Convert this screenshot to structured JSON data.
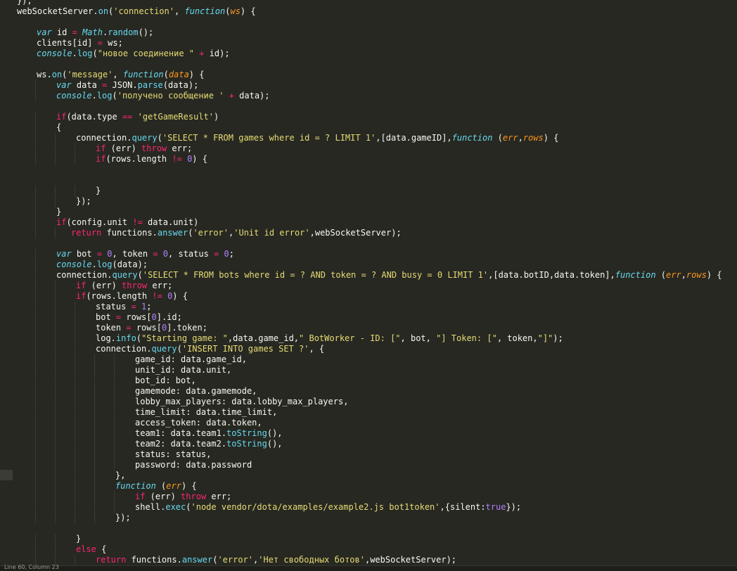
{
  "editor": {
    "theme": {
      "bg": "#272822",
      "plain": "#F8F8F2",
      "keyword": "#F92672",
      "function": "#66D9EF",
      "string": "#E6DB74",
      "number": "#AE81FF",
      "param": "#FD971F"
    },
    "lines": [
      {
        "indent": 3,
        "tokens": [
          {
            "t": "});",
            "c": "plain"
          }
        ]
      },
      {
        "indent": 3,
        "tokens": [
          {
            "t": "webSocketServer.",
            "c": "plain"
          },
          {
            "t": "on",
            "c": "fn"
          },
          {
            "t": "(",
            "c": "plain"
          },
          {
            "t": "'connection'",
            "c": "str"
          },
          {
            "t": ", ",
            "c": "plain"
          },
          {
            "t": "function",
            "c": "italic"
          },
          {
            "t": "(",
            "c": "plain"
          },
          {
            "t": "ws",
            "c": "param"
          },
          {
            "t": ") {",
            "c": "plain"
          }
        ]
      },
      {
        "indent": 0,
        "tokens": []
      },
      {
        "indent": 7,
        "tokens": [
          {
            "t": "var",
            "c": "italic"
          },
          {
            "t": " id ",
            "c": "plain"
          },
          {
            "t": "=",
            "c": "op"
          },
          {
            "t": " ",
            "c": "plain"
          },
          {
            "t": "Math",
            "c": "italic"
          },
          {
            "t": ".",
            "c": "plain"
          },
          {
            "t": "random",
            "c": "fn"
          },
          {
            "t": "();",
            "c": "plain"
          }
        ]
      },
      {
        "indent": 7,
        "tokens": [
          {
            "t": "clients[id] ",
            "c": "plain"
          },
          {
            "t": "=",
            "c": "op"
          },
          {
            "t": " ws;",
            "c": "plain"
          }
        ]
      },
      {
        "indent": 7,
        "tokens": [
          {
            "t": "console",
            "c": "italic"
          },
          {
            "t": ".",
            "c": "plain"
          },
          {
            "t": "log",
            "c": "fn"
          },
          {
            "t": "(",
            "c": "plain"
          },
          {
            "t": "\"новое соединение \"",
            "c": "str"
          },
          {
            "t": " ",
            "c": "plain"
          },
          {
            "t": "+",
            "c": "op"
          },
          {
            "t": " id);",
            "c": "plain"
          }
        ]
      },
      {
        "indent": 0,
        "tokens": []
      },
      {
        "indent": 7,
        "tokens": [
          {
            "t": "ws.",
            "c": "plain"
          },
          {
            "t": "on",
            "c": "fn"
          },
          {
            "t": "(",
            "c": "plain"
          },
          {
            "t": "'message'",
            "c": "str"
          },
          {
            "t": ", ",
            "c": "plain"
          },
          {
            "t": "function",
            "c": "italic"
          },
          {
            "t": "(",
            "c": "plain"
          },
          {
            "t": "data",
            "c": "param"
          },
          {
            "t": ") {",
            "c": "plain"
          }
        ]
      },
      {
        "indent": 11,
        "tokens": [
          {
            "t": "var",
            "c": "italic"
          },
          {
            "t": " data ",
            "c": "plain"
          },
          {
            "t": "=",
            "c": "op"
          },
          {
            "t": " JSON.",
            "c": "plain"
          },
          {
            "t": "parse",
            "c": "fn"
          },
          {
            "t": "(data);",
            "c": "plain"
          }
        ]
      },
      {
        "indent": 11,
        "tokens": [
          {
            "t": "console",
            "c": "italic"
          },
          {
            "t": ".",
            "c": "plain"
          },
          {
            "t": "log",
            "c": "fn"
          },
          {
            "t": "(",
            "c": "plain"
          },
          {
            "t": "'получено сообщение '",
            "c": "str"
          },
          {
            "t": " ",
            "c": "plain"
          },
          {
            "t": "+",
            "c": "op"
          },
          {
            "t": " data);",
            "c": "plain"
          }
        ]
      },
      {
        "indent": 0,
        "tokens": []
      },
      {
        "indent": 11,
        "tokens": [
          {
            "t": "if",
            "c": "key"
          },
          {
            "t": "(data.type ",
            "c": "plain"
          },
          {
            "t": "==",
            "c": "op"
          },
          {
            "t": " ",
            "c": "plain"
          },
          {
            "t": "'getGameResult'",
            "c": "str"
          },
          {
            "t": ")",
            "c": "plain"
          }
        ]
      },
      {
        "indent": 11,
        "tokens": [
          {
            "t": "{",
            "c": "plain"
          }
        ]
      },
      {
        "indent": 15,
        "tokens": [
          {
            "t": "connection.",
            "c": "plain"
          },
          {
            "t": "query",
            "c": "fn"
          },
          {
            "t": "(",
            "c": "plain"
          },
          {
            "t": "'SELECT * FROM games where id = ? LIMIT 1'",
            "c": "str"
          },
          {
            "t": ",[data.gameID],",
            "c": "plain"
          },
          {
            "t": "function",
            "c": "italic"
          },
          {
            "t": " (",
            "c": "plain"
          },
          {
            "t": "err",
            "c": "param"
          },
          {
            "t": ",",
            "c": "plain"
          },
          {
            "t": "rows",
            "c": "param"
          },
          {
            "t": ") {",
            "c": "plain"
          }
        ]
      },
      {
        "indent": 19,
        "tokens": [
          {
            "t": "if",
            "c": "key"
          },
          {
            "t": " (err) ",
            "c": "plain"
          },
          {
            "t": "throw",
            "c": "key"
          },
          {
            "t": " err;",
            "c": "plain"
          }
        ]
      },
      {
        "indent": 19,
        "tokens": [
          {
            "t": "if",
            "c": "key"
          },
          {
            "t": "(rows.length ",
            "c": "plain"
          },
          {
            "t": "!=",
            "c": "op"
          },
          {
            "t": " ",
            "c": "plain"
          },
          {
            "t": "0",
            "c": "num"
          },
          {
            "t": ") {",
            "c": "plain"
          }
        ]
      },
      {
        "indent": 0,
        "tokens": []
      },
      {
        "indent": 0,
        "tokens": []
      },
      {
        "indent": 19,
        "tokens": [
          {
            "t": "}",
            "c": "plain"
          }
        ]
      },
      {
        "indent": 15,
        "tokens": [
          {
            "t": "});",
            "c": "plain"
          }
        ]
      },
      {
        "indent": 11,
        "tokens": [
          {
            "t": "}",
            "c": "plain"
          }
        ]
      },
      {
        "indent": 11,
        "tokens": [
          {
            "t": "if",
            "c": "key"
          },
          {
            "t": "(config.unit ",
            "c": "plain"
          },
          {
            "t": "!=",
            "c": "op"
          },
          {
            "t": " data.unit)",
            "c": "plain"
          }
        ]
      },
      {
        "indent": 14,
        "tokens": [
          {
            "t": "return",
            "c": "key"
          },
          {
            "t": " functions.",
            "c": "plain"
          },
          {
            "t": "answer",
            "c": "fn"
          },
          {
            "t": "(",
            "c": "plain"
          },
          {
            "t": "'error'",
            "c": "str"
          },
          {
            "t": ",",
            "c": "plain"
          },
          {
            "t": "'Unit id error'",
            "c": "str"
          },
          {
            "t": ",webSocketServer);",
            "c": "plain"
          }
        ]
      },
      {
        "indent": 0,
        "tokens": []
      },
      {
        "indent": 11,
        "tokens": [
          {
            "t": "var",
            "c": "italic"
          },
          {
            "t": " bot ",
            "c": "plain"
          },
          {
            "t": "=",
            "c": "op"
          },
          {
            "t": " ",
            "c": "plain"
          },
          {
            "t": "0",
            "c": "num"
          },
          {
            "t": ", token ",
            "c": "plain"
          },
          {
            "t": "=",
            "c": "op"
          },
          {
            "t": " ",
            "c": "plain"
          },
          {
            "t": "0",
            "c": "num"
          },
          {
            "t": ", status ",
            "c": "plain"
          },
          {
            "t": "=",
            "c": "op"
          },
          {
            "t": " ",
            "c": "plain"
          },
          {
            "t": "0",
            "c": "num"
          },
          {
            "t": ";",
            "c": "plain"
          }
        ]
      },
      {
        "indent": 11,
        "tokens": [
          {
            "t": "console",
            "c": "italic"
          },
          {
            "t": ".",
            "c": "plain"
          },
          {
            "t": "log",
            "c": "fn"
          },
          {
            "t": "(data);",
            "c": "plain"
          }
        ]
      },
      {
        "indent": 11,
        "tokens": [
          {
            "t": "connection.",
            "c": "plain"
          },
          {
            "t": "query",
            "c": "fn"
          },
          {
            "t": "(",
            "c": "plain"
          },
          {
            "t": "'SELECT * FROM bots where id = ? AND token = ? AND busy = 0 LIMIT 1'",
            "c": "str"
          },
          {
            "t": ",[data.botID,data.token],",
            "c": "plain"
          },
          {
            "t": "function",
            "c": "italic"
          },
          {
            "t": " (",
            "c": "plain"
          },
          {
            "t": "err",
            "c": "param"
          },
          {
            "t": ",",
            "c": "plain"
          },
          {
            "t": "rows",
            "c": "param"
          },
          {
            "t": ") {",
            "c": "plain"
          }
        ]
      },
      {
        "indent": 15,
        "tokens": [
          {
            "t": "if",
            "c": "key"
          },
          {
            "t": " (err) ",
            "c": "plain"
          },
          {
            "t": "throw",
            "c": "key"
          },
          {
            "t": " err;",
            "c": "plain"
          }
        ]
      },
      {
        "indent": 15,
        "tokens": [
          {
            "t": "if",
            "c": "key"
          },
          {
            "t": "(rows.length ",
            "c": "plain"
          },
          {
            "t": "!=",
            "c": "op"
          },
          {
            "t": " ",
            "c": "plain"
          },
          {
            "t": "0",
            "c": "num"
          },
          {
            "t": ") {",
            "c": "plain"
          }
        ]
      },
      {
        "indent": 19,
        "tokens": [
          {
            "t": "status ",
            "c": "plain"
          },
          {
            "t": "=",
            "c": "op"
          },
          {
            "t": " ",
            "c": "plain"
          },
          {
            "t": "1",
            "c": "num"
          },
          {
            "t": ";",
            "c": "plain"
          }
        ]
      },
      {
        "indent": 19,
        "tokens": [
          {
            "t": "bot ",
            "c": "plain"
          },
          {
            "t": "=",
            "c": "op"
          },
          {
            "t": " rows[",
            "c": "plain"
          },
          {
            "t": "0",
            "c": "num"
          },
          {
            "t": "].id;",
            "c": "plain"
          }
        ]
      },
      {
        "indent": 19,
        "tokens": [
          {
            "t": "token ",
            "c": "plain"
          },
          {
            "t": "=",
            "c": "op"
          },
          {
            "t": " rows[",
            "c": "plain"
          },
          {
            "t": "0",
            "c": "num"
          },
          {
            "t": "].token;",
            "c": "plain"
          }
        ]
      },
      {
        "indent": 19,
        "tokens": [
          {
            "t": "log.",
            "c": "plain"
          },
          {
            "t": "info",
            "c": "fn"
          },
          {
            "t": "(",
            "c": "plain"
          },
          {
            "t": "\"Starting game: \"",
            "c": "str"
          },
          {
            "t": ",data.game_id,",
            "c": "plain"
          },
          {
            "t": "\" BotWorker - ID: [\"",
            "c": "str"
          },
          {
            "t": ", bot, ",
            "c": "plain"
          },
          {
            "t": "\"] Token: [\"",
            "c": "str"
          },
          {
            "t": ", token,",
            "c": "plain"
          },
          {
            "t": "\"]\"",
            "c": "str"
          },
          {
            "t": ");",
            "c": "plain"
          }
        ]
      },
      {
        "indent": 19,
        "tokens": [
          {
            "t": "connection.",
            "c": "plain"
          },
          {
            "t": "query",
            "c": "fn"
          },
          {
            "t": "(",
            "c": "plain"
          },
          {
            "t": "'INSERT INTO games SET ?'",
            "c": "str"
          },
          {
            "t": ", {",
            "c": "plain"
          }
        ]
      },
      {
        "indent": 27,
        "tokens": [
          {
            "t": "game_id: data.game_id,",
            "c": "plain"
          }
        ]
      },
      {
        "indent": 27,
        "tokens": [
          {
            "t": "unit_id: data.unit,",
            "c": "plain"
          }
        ]
      },
      {
        "indent": 27,
        "tokens": [
          {
            "t": "bot_id: bot,",
            "c": "plain"
          }
        ]
      },
      {
        "indent": 27,
        "tokens": [
          {
            "t": "gamemode: data.gamemode,",
            "c": "plain"
          }
        ]
      },
      {
        "indent": 27,
        "tokens": [
          {
            "t": "lobby_max_players: data.lobby_max_players,",
            "c": "plain"
          }
        ]
      },
      {
        "indent": 27,
        "tokens": [
          {
            "t": "time_limit: data.time_limit,",
            "c": "plain"
          }
        ]
      },
      {
        "indent": 27,
        "tokens": [
          {
            "t": "access_token: data.token,",
            "c": "plain"
          }
        ]
      },
      {
        "indent": 27,
        "tokens": [
          {
            "t": "team1: data.team1.",
            "c": "plain"
          },
          {
            "t": "toString",
            "c": "fn"
          },
          {
            "t": "(),",
            "c": "plain"
          }
        ]
      },
      {
        "indent": 27,
        "tokens": [
          {
            "t": "team2: data.team2.",
            "c": "plain"
          },
          {
            "t": "toString",
            "c": "fn"
          },
          {
            "t": "(),",
            "c": "plain"
          }
        ]
      },
      {
        "indent": 27,
        "tokens": [
          {
            "t": "status: status,",
            "c": "plain"
          }
        ]
      },
      {
        "indent": 27,
        "tokens": [
          {
            "t": "password: data.password",
            "c": "plain"
          }
        ]
      },
      {
        "indent": 23,
        "tokens": [
          {
            "t": "},",
            "c": "plain"
          }
        ]
      },
      {
        "indent": 23,
        "tokens": [
          {
            "t": "function",
            "c": "italic"
          },
          {
            "t": " (",
            "c": "plain"
          },
          {
            "t": "err",
            "c": "param"
          },
          {
            "t": ") {",
            "c": "plain"
          }
        ]
      },
      {
        "indent": 27,
        "tokens": [
          {
            "t": "if",
            "c": "key"
          },
          {
            "t": " (err) ",
            "c": "plain"
          },
          {
            "t": "throw",
            "c": "key"
          },
          {
            "t": " err;",
            "c": "plain"
          }
        ]
      },
      {
        "indent": 27,
        "tokens": [
          {
            "t": "shell.",
            "c": "plain"
          },
          {
            "t": "exec",
            "c": "fn"
          },
          {
            "t": "(",
            "c": "plain"
          },
          {
            "t": "'node vendor/dota/examples/example2.js bot1token'",
            "c": "str"
          },
          {
            "t": ",{silent:",
            "c": "plain"
          },
          {
            "t": "true",
            "c": "num"
          },
          {
            "t": "});",
            "c": "plain"
          }
        ]
      },
      {
        "indent": 23,
        "tokens": [
          {
            "t": "});",
            "c": "plain"
          }
        ]
      },
      {
        "indent": 0,
        "tokens": []
      },
      {
        "indent": 15,
        "tokens": [
          {
            "t": "}",
            "c": "plain"
          }
        ]
      },
      {
        "indent": 15,
        "tokens": [
          {
            "t": "else",
            "c": "key"
          },
          {
            "t": " {",
            "c": "plain"
          }
        ]
      },
      {
        "indent": 19,
        "tokens": [
          {
            "t": "return",
            "c": "key"
          },
          {
            "t": " functions.",
            "c": "plain"
          },
          {
            "t": "answer",
            "c": "fn"
          },
          {
            "t": "(",
            "c": "plain"
          },
          {
            "t": "'error'",
            "c": "str"
          },
          {
            "t": ",",
            "c": "plain"
          },
          {
            "t": "'Нет свободных ботов'",
            "c": "str"
          },
          {
            "t": ",webSocketServer);",
            "c": "plain"
          }
        ]
      }
    ]
  },
  "statusbar": {
    "text": "Line 60, Column 23"
  }
}
